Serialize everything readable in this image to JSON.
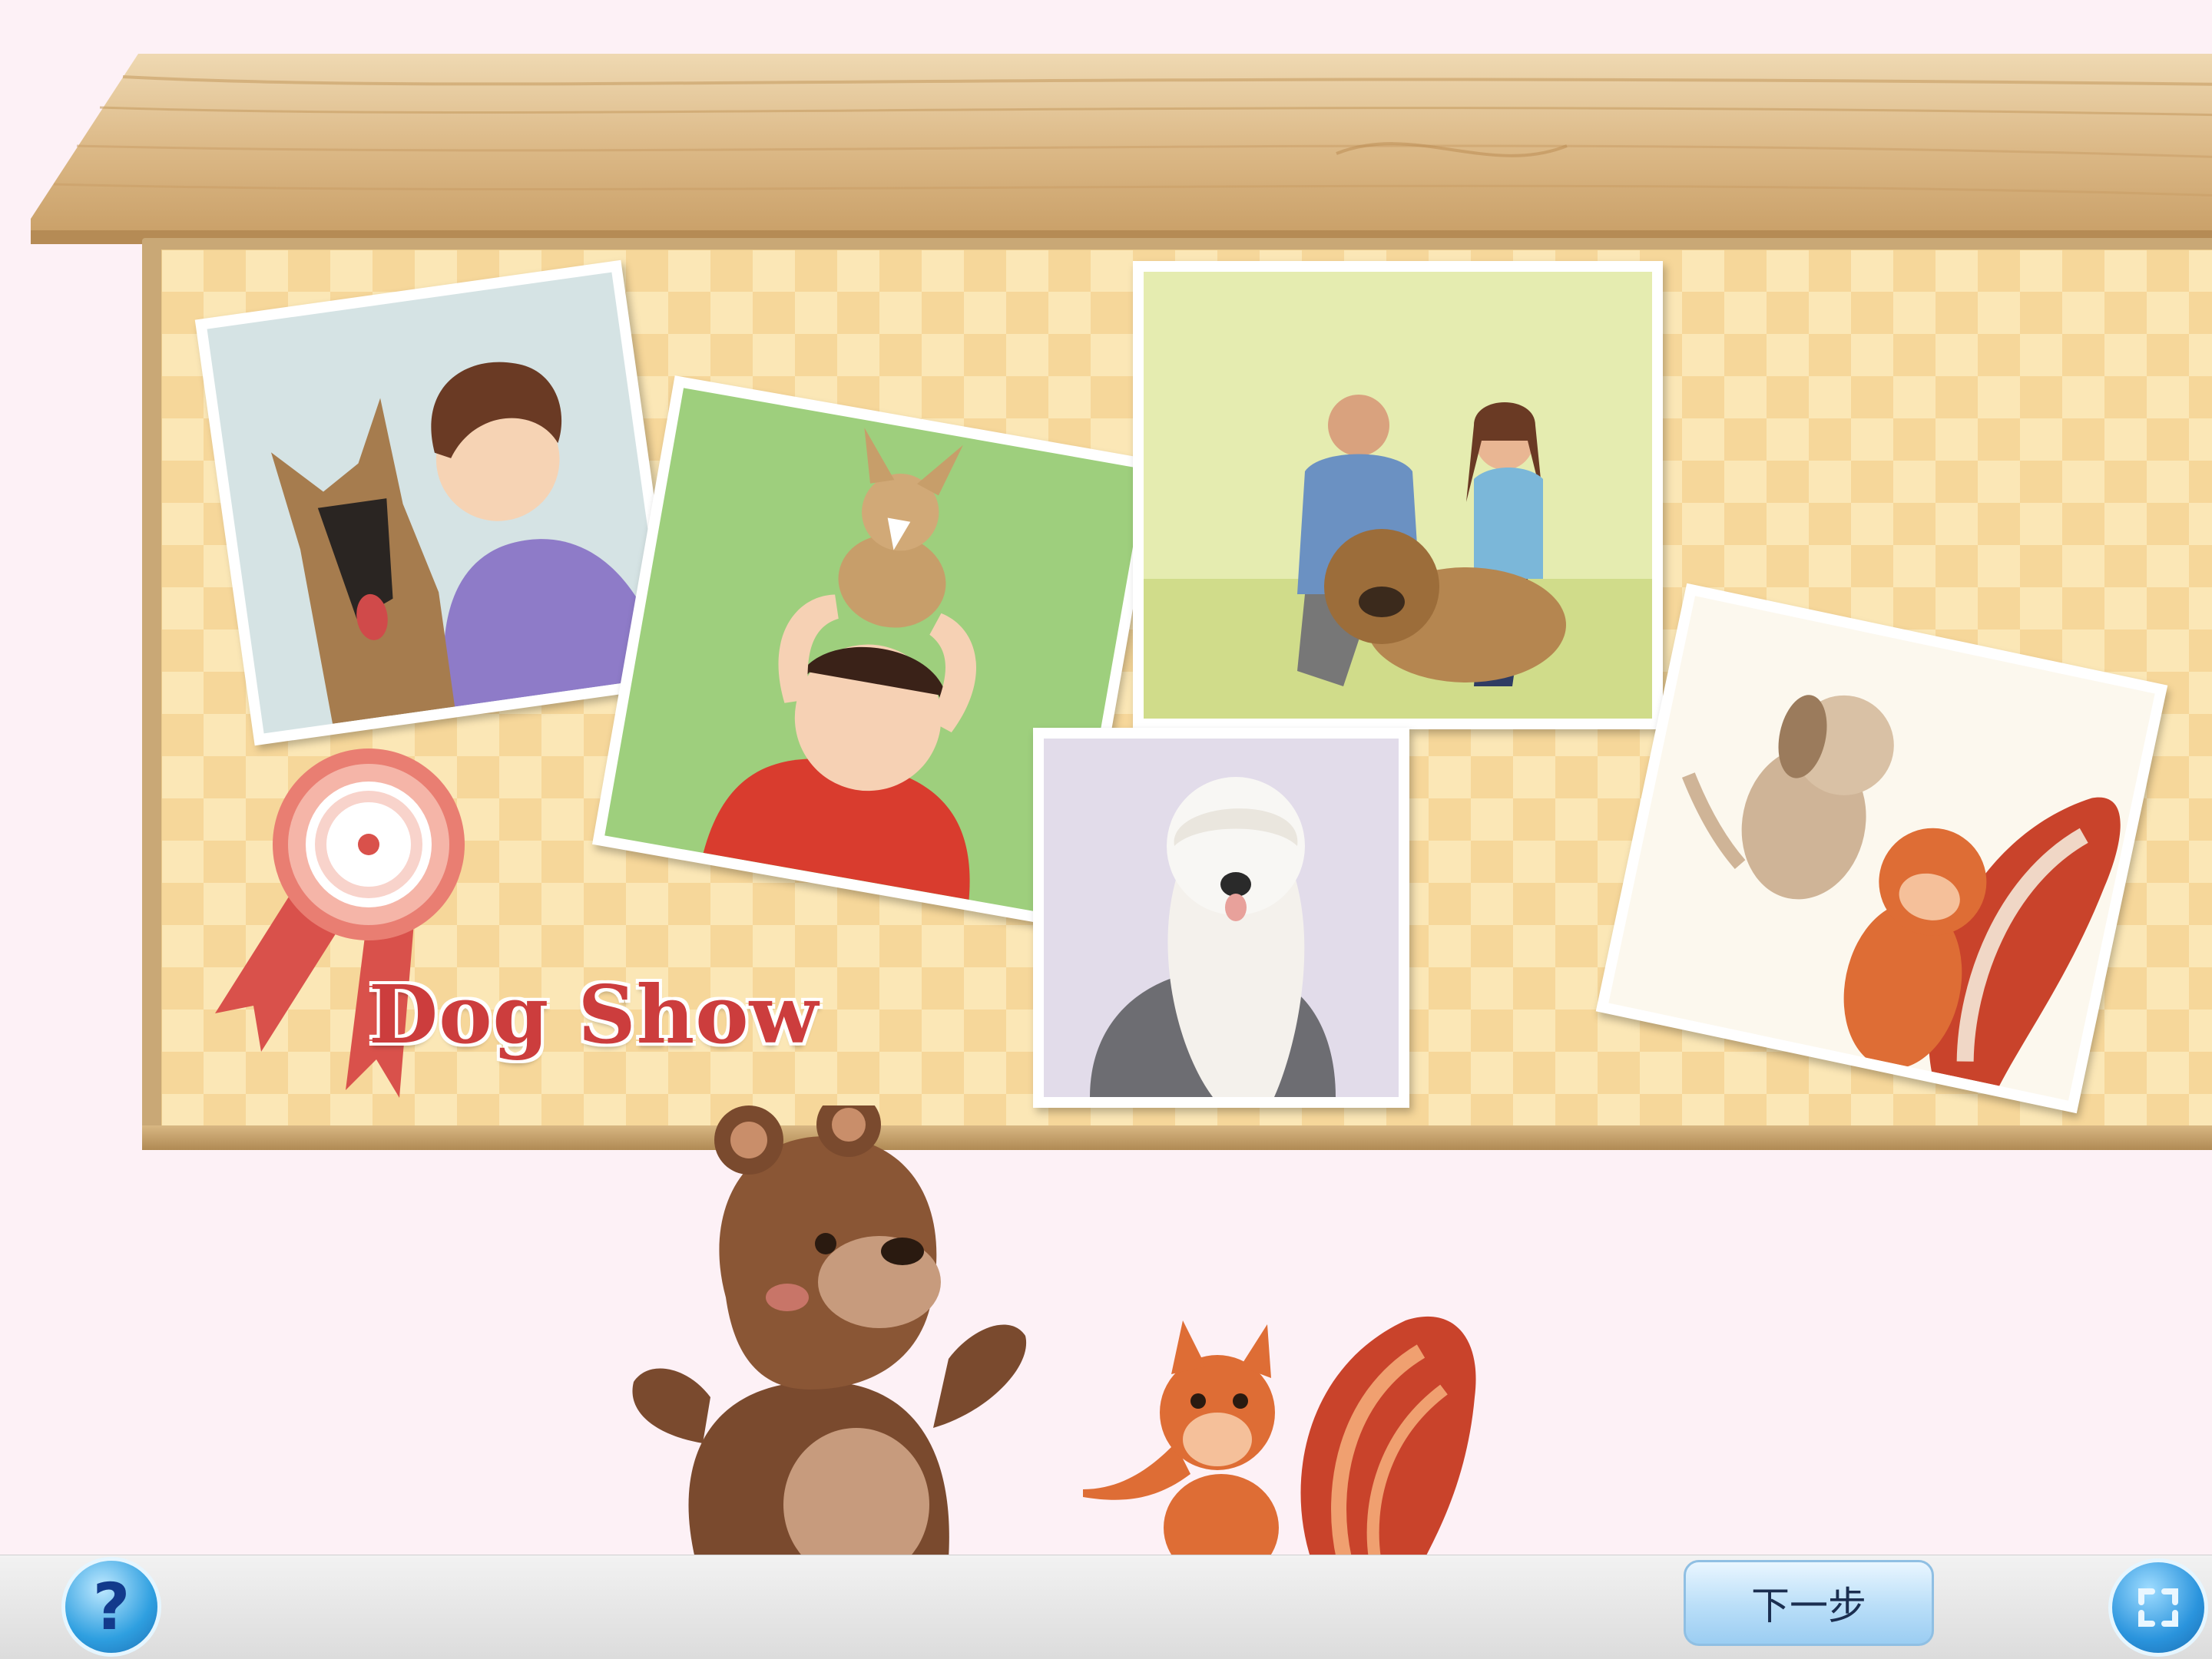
{
  "board": {
    "title": "Dog Show",
    "photos": [
      {
        "name": "photo-boy-shepherd",
        "caption": ""
      },
      {
        "name": "photo-girl-chihuahua",
        "caption": ""
      },
      {
        "name": "photo-couple-chow",
        "caption": ""
      },
      {
        "name": "photo-sheepdog",
        "caption": ""
      },
      {
        "name": "photo-squirrel-puppy",
        "caption": ""
      }
    ]
  },
  "toolbar": {
    "help_label": "?",
    "next_label": "下一步",
    "help_icon": "question-icon",
    "fullscreen_icon": "fullscreen-icon"
  },
  "colors": {
    "background": "#fdf1f6",
    "board_pattern": "#f6d79a",
    "title": "#cc3d3d",
    "button_blue": "#2e9fe0"
  }
}
